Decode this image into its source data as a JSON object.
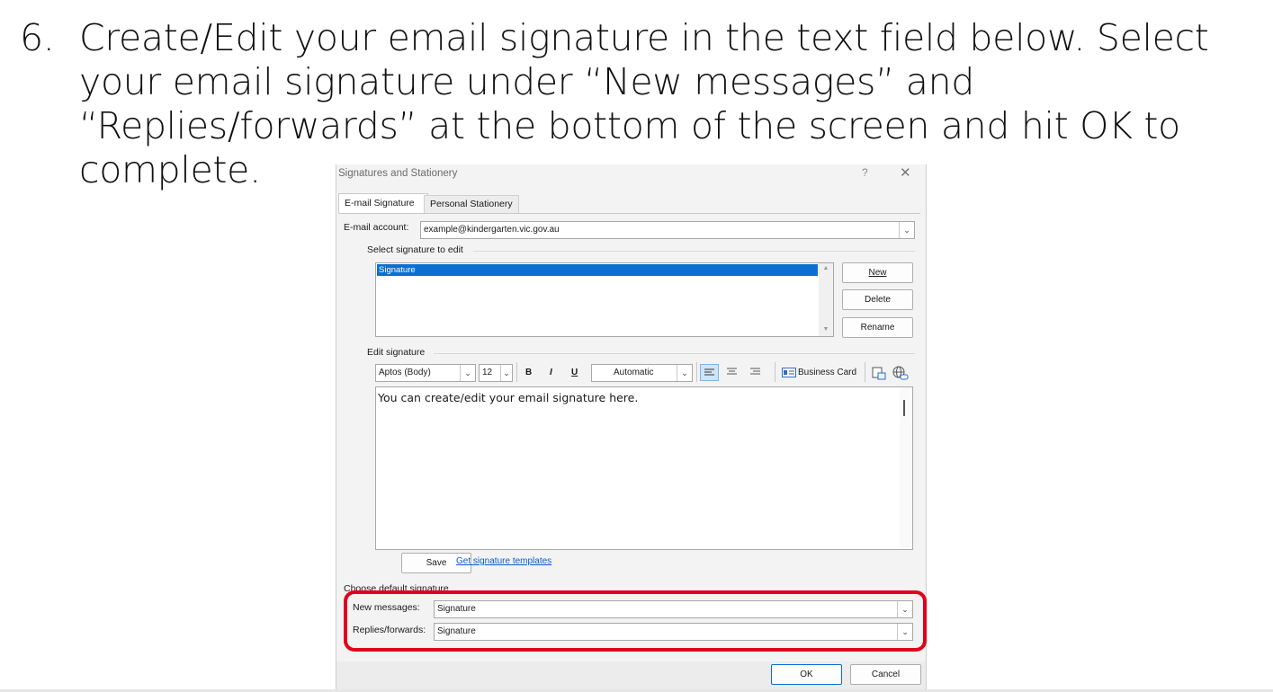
{
  "instruction": {
    "number": "6.",
    "text": "Create/Edit your email signature in the text field below. Select your email signature under “New messages” and “Replies/forwards” at the bottom of the screen and hit OK to complete."
  },
  "dialog": {
    "title": "Signatures and Stationery",
    "help_label": "?",
    "close_label": "✕",
    "tabs": [
      {
        "label": "E-mail Signature",
        "active": true
      },
      {
        "label": "Personal Stationery",
        "active": false
      }
    ],
    "email_account": {
      "label": "E-mail account:",
      "value": "example@kindergarten.vic.gov.au"
    },
    "select_signature": {
      "label": "Select signature to edit",
      "items": [
        "Signature"
      ],
      "selected": "Signature"
    },
    "buttons": {
      "new": "New",
      "delete": "Delete",
      "rename": "Rename",
      "save": "Save",
      "ok": "OK",
      "cancel": "Cancel"
    },
    "edit_signature": {
      "label": "Edit signature",
      "font": "Aptos (Body)",
      "size": "12",
      "bold": "B",
      "italic": "I",
      "underline": "U",
      "color": "Automatic",
      "business_card": "Business Card",
      "content": "You can create/edit your email signature here."
    },
    "templates_link": "Get signature templates",
    "default_signature": {
      "label": "Choose default signature",
      "new_messages_label": "New messages:",
      "new_messages_value": "Signature",
      "replies_label": "Replies/forwards:",
      "replies_value": "Signature"
    },
    "accent_color": "#0a6fd1",
    "highlight_color": "#e0001b"
  }
}
